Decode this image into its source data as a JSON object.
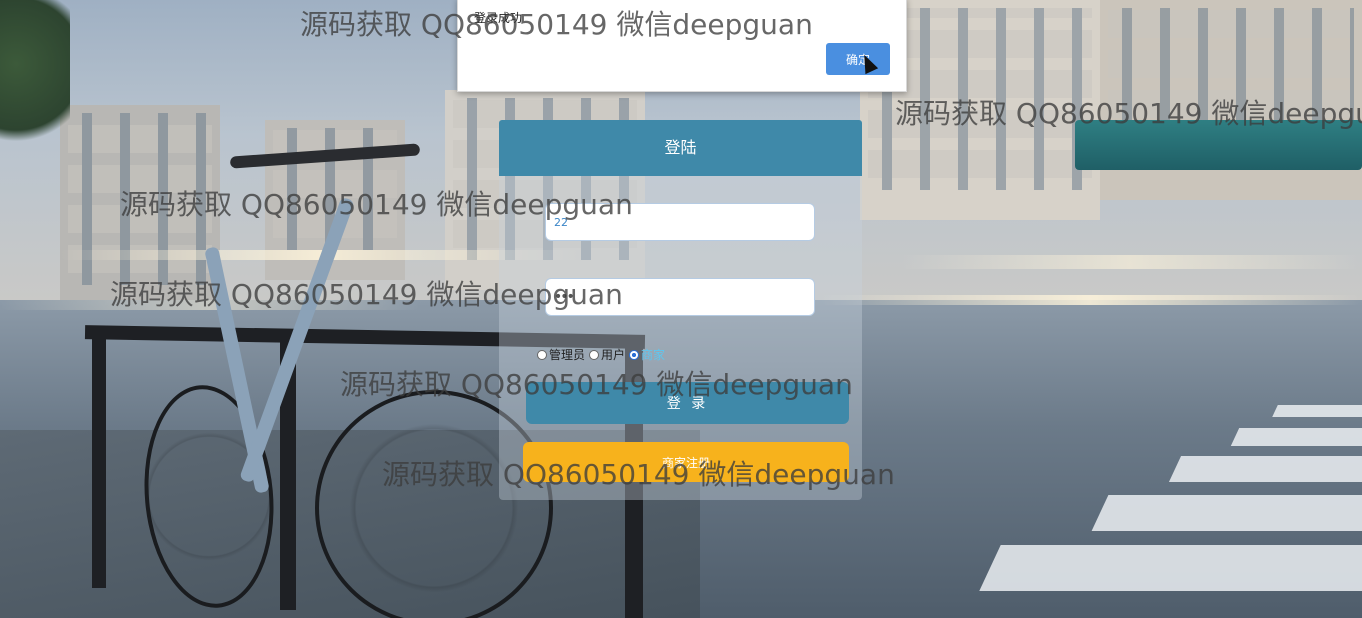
{
  "dialog": {
    "message": "登录成功",
    "ok_label": "确定"
  },
  "login": {
    "title": "登陆",
    "username_value": "22",
    "password_value": "•••",
    "roles": [
      {
        "label": "管理员",
        "selected": false
      },
      {
        "label": "用户",
        "selected": false
      },
      {
        "label": "商家",
        "selected": true
      }
    ],
    "login_label": "登 录",
    "register_label": "商家注册"
  },
  "watermark": {
    "text": "源码获取 QQ86050149 微信deepguan"
  },
  "colors": {
    "panel_header": "#3f89a9",
    "login_button": "#3f89a9",
    "register_button": "#f7b21c",
    "dialog_ok": "#4a8fe0",
    "selected_role": "#5ec7f0"
  }
}
